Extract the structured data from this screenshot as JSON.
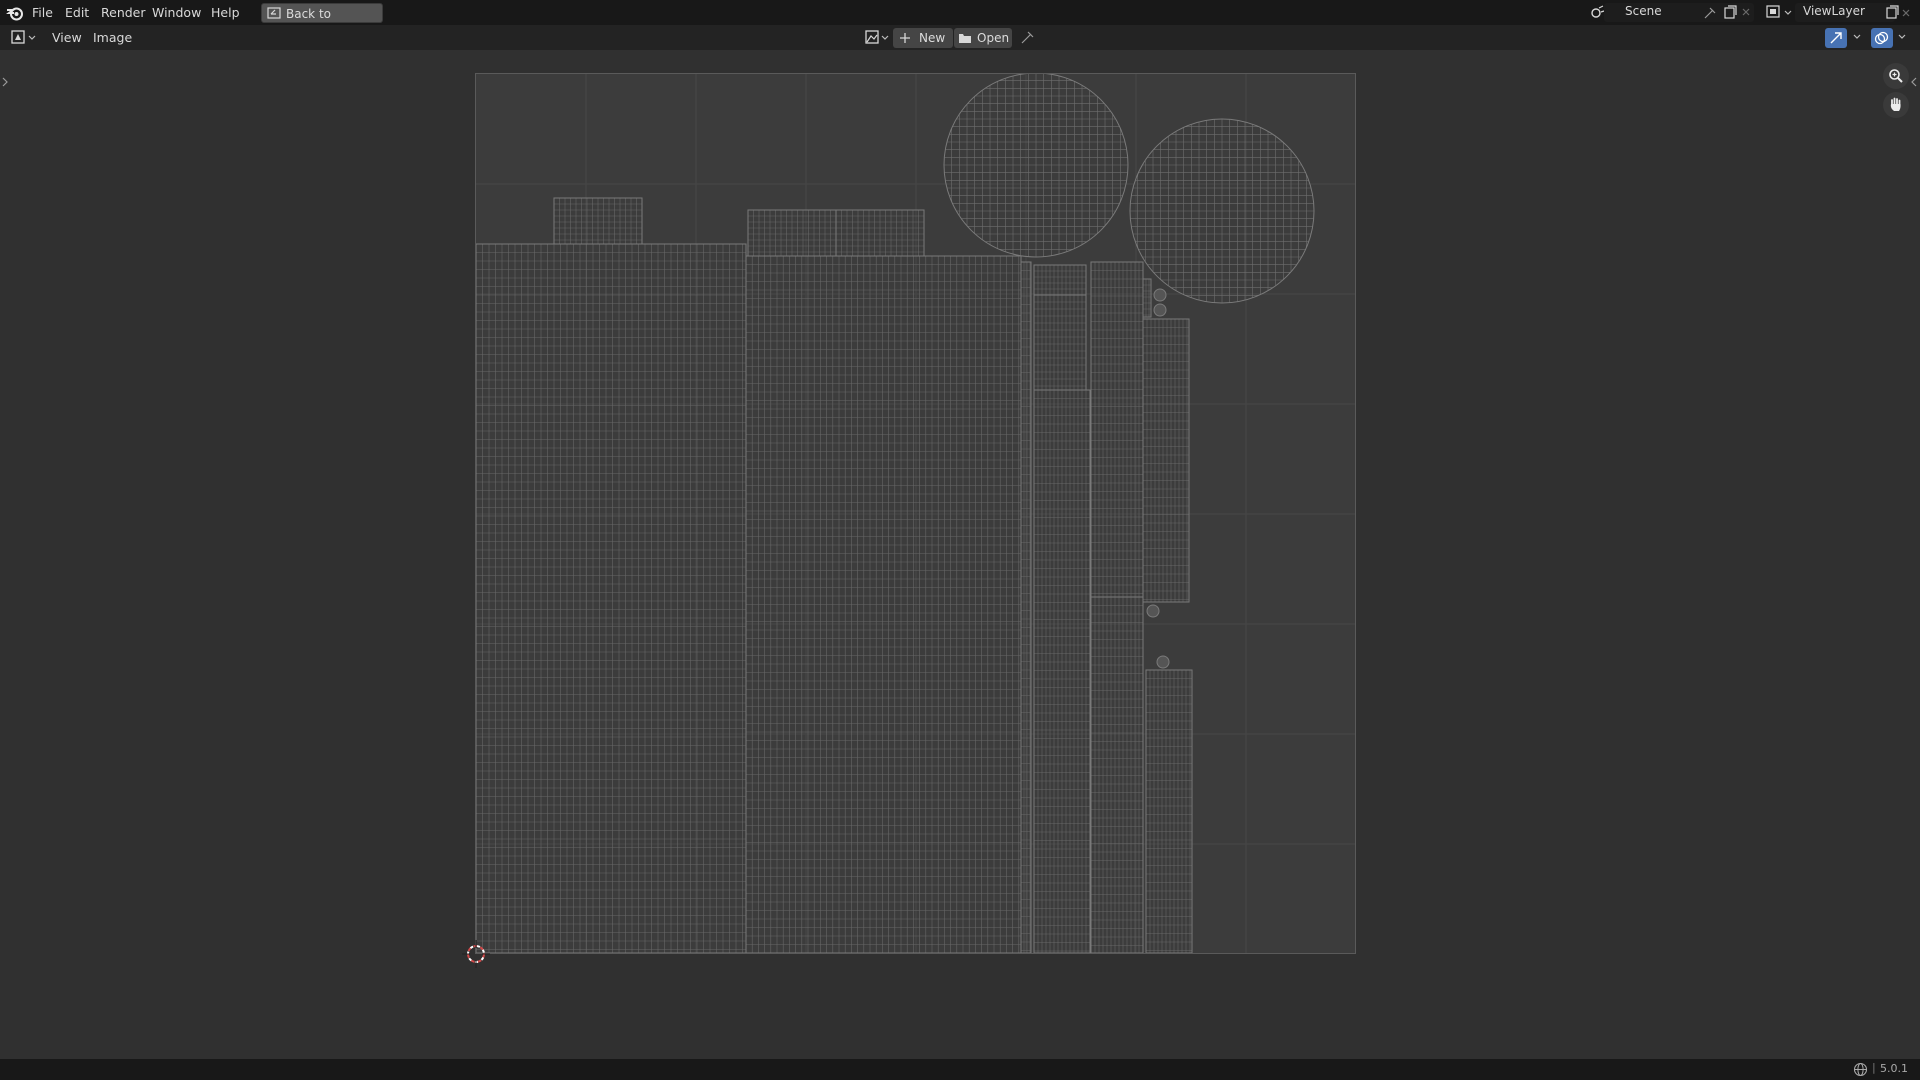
{
  "topbar": {
    "menu": [
      "File",
      "Edit",
      "Render",
      "Window",
      "Help"
    ],
    "back_label": "Back to Previous",
    "scene_name": "Scene",
    "viewlayer_name": "ViewLayer"
  },
  "editor_header": {
    "menu": [
      "View",
      "Image"
    ],
    "new_label": "New",
    "open_label": "Open"
  },
  "status": {
    "version": "5.0.1"
  },
  "colors": {
    "background": "#303030",
    "topbar": "#181818",
    "header": "#232323",
    "uv_lines": "#6e6e6e",
    "active_blue": "#4772b3",
    "cursor_red": "#d24a4a"
  },
  "icons": [
    "blender-logo-icon",
    "back-icon",
    "scene-icon",
    "pin-icon",
    "new-scene-icon",
    "close-icon",
    "viewlayer-icon",
    "editor-type-icon",
    "image-browse-icon",
    "plus-icon",
    "folder-icon",
    "zoom-icon",
    "hand-icon",
    "uv-sync-icon",
    "overlay-icon",
    "2d-cursor-icon"
  ]
}
